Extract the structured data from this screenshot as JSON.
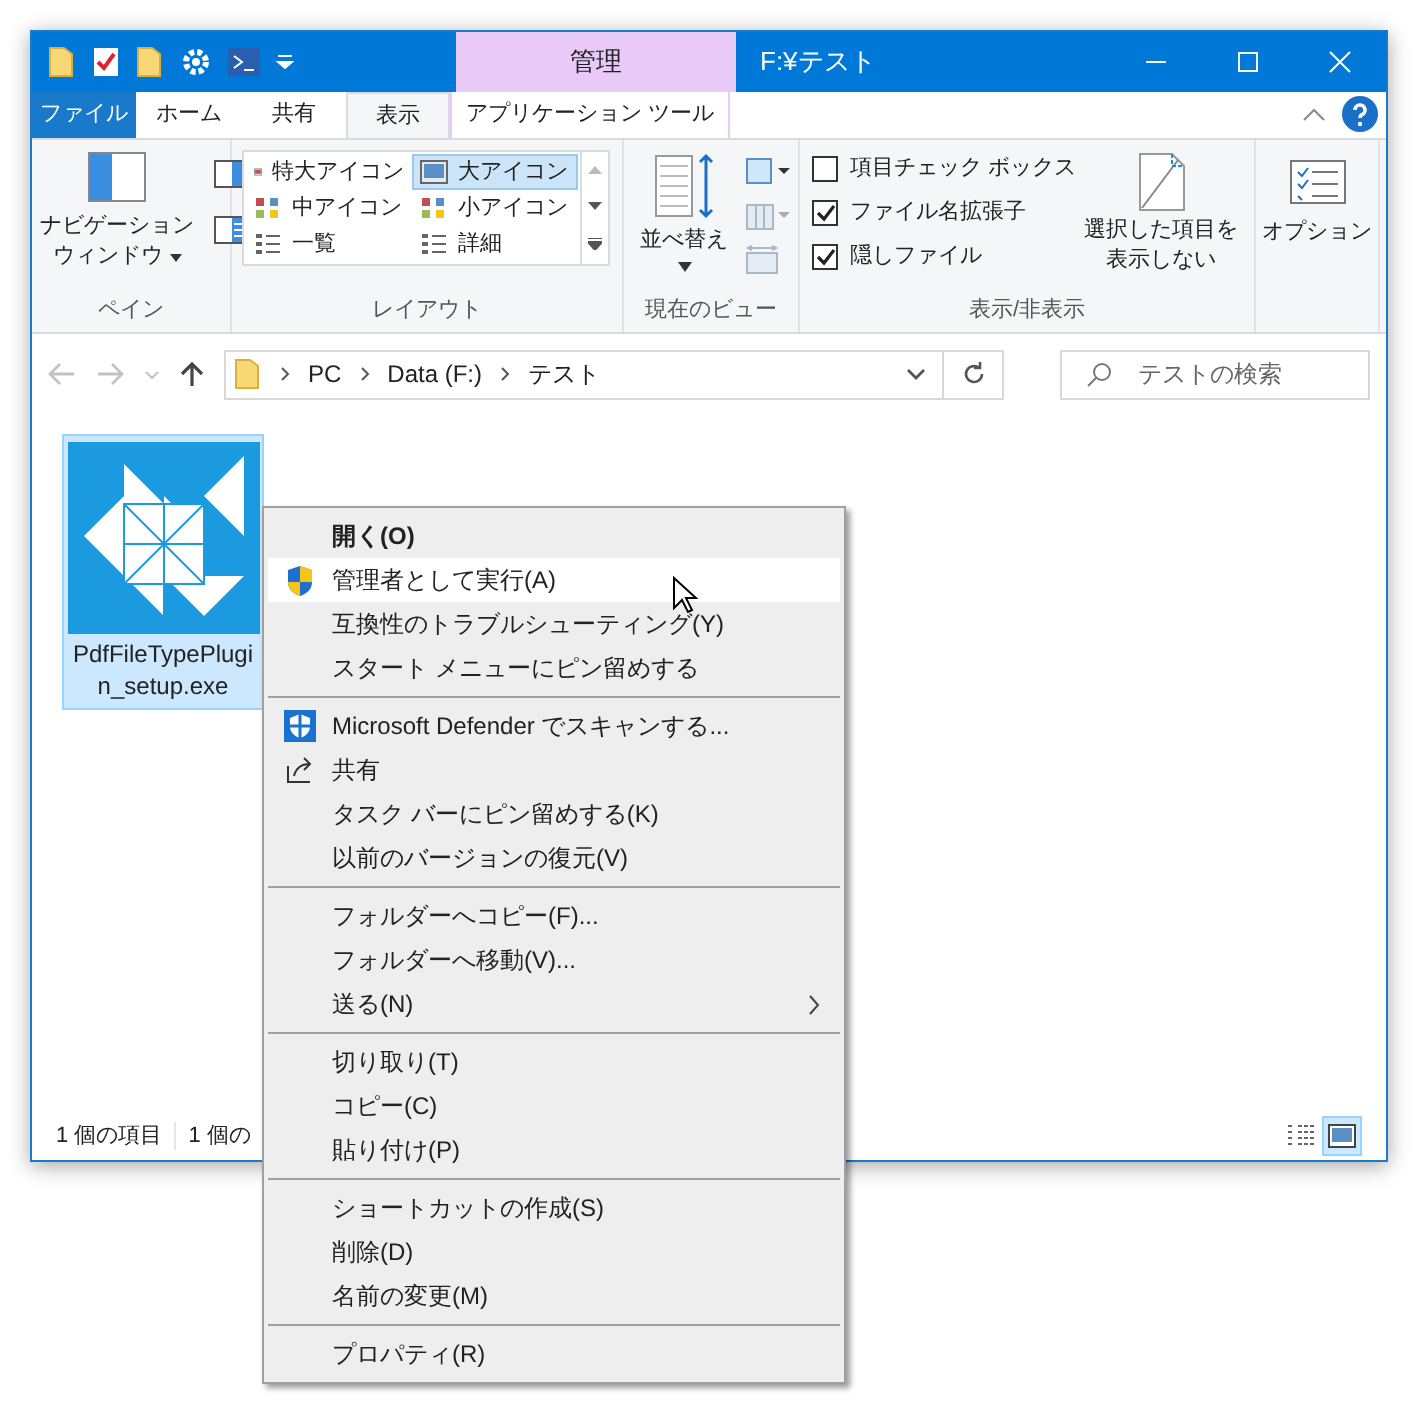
{
  "title_bar": {
    "context_tab": "管理",
    "title": "F:¥テスト"
  },
  "ribbon_tabs": [
    {
      "label": "ファイル",
      "kind": "file",
      "selected": false
    },
    {
      "label": "ホーム",
      "kind": "normal",
      "selected": false
    },
    {
      "label": "共有",
      "kind": "normal",
      "selected": false
    },
    {
      "label": "表示",
      "kind": "normal",
      "selected": true
    },
    {
      "label": "アプリケーション ツール",
      "kind": "context",
      "selected": false
    }
  ],
  "ribbon": {
    "pane": {
      "navigation_button": [
        "ナビゲーション",
        "ウィンドウ"
      ],
      "group_label": "ペイン"
    },
    "layout": {
      "items": [
        {
          "label": "特大アイコン",
          "selected": false
        },
        {
          "label": "大アイコン",
          "selected": true
        },
        {
          "label": "中アイコン",
          "selected": false
        },
        {
          "label": "小アイコン",
          "selected": false
        },
        {
          "label": "一覧",
          "selected": false
        },
        {
          "label": "詳細",
          "selected": false
        }
      ],
      "group_label": "レイアウト"
    },
    "current_view": {
      "sort_button": "並べ替え",
      "group_label": "現在のビュー"
    },
    "show_hide": {
      "checkboxes": [
        {
          "label": "項目チェック ボックス",
          "checked": false
        },
        {
          "label": "ファイル名拡張子",
          "checked": true
        },
        {
          "label": "隠しファイル",
          "checked": true
        }
      ],
      "hide_button": [
        "選択した項目を",
        "表示しない"
      ],
      "group_label": "表示/非表示"
    },
    "options_button": "オプション"
  },
  "address": {
    "path": [
      "PC",
      "Data (F:)",
      "テスト"
    ],
    "search_placeholder": "テストの検索"
  },
  "files": [
    {
      "name": "PdfFileTypePlugin_setup.exe",
      "selected": true
    }
  ],
  "status_bar": [
    "1 個の項目",
    "1 個の"
  ],
  "view_buttons": [
    {
      "kind": "details",
      "selected": false
    },
    {
      "kind": "large",
      "selected": true
    }
  ],
  "context_menu": [
    [
      {
        "label": "開く(O)",
        "kind": "default",
        "selected": false
      },
      {
        "label": "管理者として実行(A)",
        "kind": "shield",
        "selected": true
      },
      {
        "label": "互換性のトラブルシューティング(Y)",
        "kind": "plain",
        "selected": false
      },
      {
        "label": "スタート メニューにピン留めする",
        "kind": "plain",
        "selected": false
      }
    ],
    [
      {
        "label": "Microsoft Defender でスキャンする...",
        "kind": "defender",
        "selected": false
      },
      {
        "label": "共有",
        "kind": "share",
        "selected": false
      },
      {
        "label": "タスク バーにピン留めする(K)",
        "kind": "plain",
        "selected": false
      },
      {
        "label": "以前のバージョンの復元(V)",
        "kind": "plain",
        "selected": false
      }
    ],
    [
      {
        "label": "フォルダーへコピー(F)...",
        "kind": "plain",
        "selected": false
      },
      {
        "label": "フォルダーへ移動(V)...",
        "kind": "plain",
        "selected": false
      },
      {
        "label": "送る(N)",
        "kind": "submenu",
        "selected": false
      }
    ],
    [
      {
        "label": "切り取り(T)",
        "kind": "plain",
        "selected": false
      },
      {
        "label": "コピー(C)",
        "kind": "plain",
        "selected": false
      },
      {
        "label": "貼り付け(P)",
        "kind": "plain",
        "selected": false
      }
    ],
    [
      {
        "label": "ショートカットの作成(S)",
        "kind": "plain",
        "selected": false
      },
      {
        "label": "削除(D)",
        "kind": "plain",
        "selected": false
      },
      {
        "label": "名前の変更(M)",
        "kind": "plain",
        "selected": false
      }
    ],
    [
      {
        "label": "プロパティ(R)",
        "kind": "plain",
        "selected": false
      }
    ]
  ]
}
